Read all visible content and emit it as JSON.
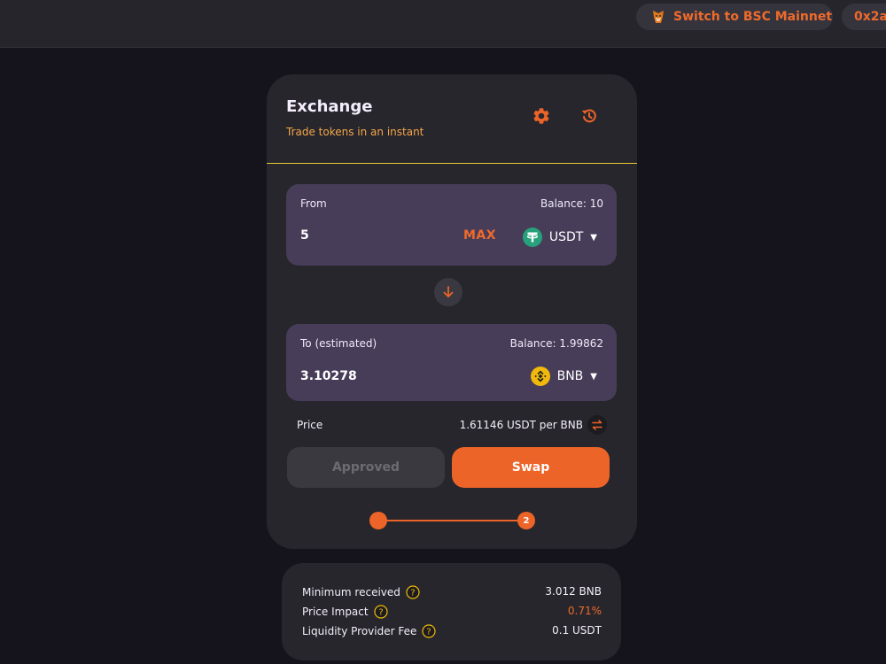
{
  "topbar": {
    "network_button": {
      "label": "Switch to BSC Mainnet",
      "icon": "fox-icon"
    },
    "address_button": {
      "label": "0x2a"
    }
  },
  "exchange": {
    "title": "Exchange",
    "subtitle": "Trade tokens in an instant",
    "from": {
      "label": "From",
      "balance": "Balance: 10",
      "amount": "5",
      "max_label": "MAX",
      "token": "USDT",
      "token_icon": "tether-icon"
    },
    "to": {
      "label": "To (estimated)",
      "balance": "Balance: 1.99862",
      "amount": "3.10278",
      "token": "BNB",
      "token_icon": "bnb-icon"
    },
    "price": {
      "label": "Price",
      "value": "1.61146 USDT per BNB"
    },
    "approved_label": "Approved",
    "swap_label": "Swap",
    "stepper": {
      "current_step": 2,
      "total_steps": 2,
      "step2_label": "2"
    }
  },
  "details": {
    "minimum_received": {
      "label": "Minimum received",
      "value": "3.012 BNB"
    },
    "price_impact": {
      "label": "Price Impact",
      "value": "0.71%"
    },
    "lp_fee": {
      "label": "Liquidity Provider Fee",
      "value": "0.1 USDT"
    }
  },
  "colors": {
    "accent": "#ec6428",
    "subtitle": "#f3a64a",
    "divider": "#e9c934",
    "panel": "#473d58",
    "card": "#27262c",
    "background": "#15131c"
  }
}
